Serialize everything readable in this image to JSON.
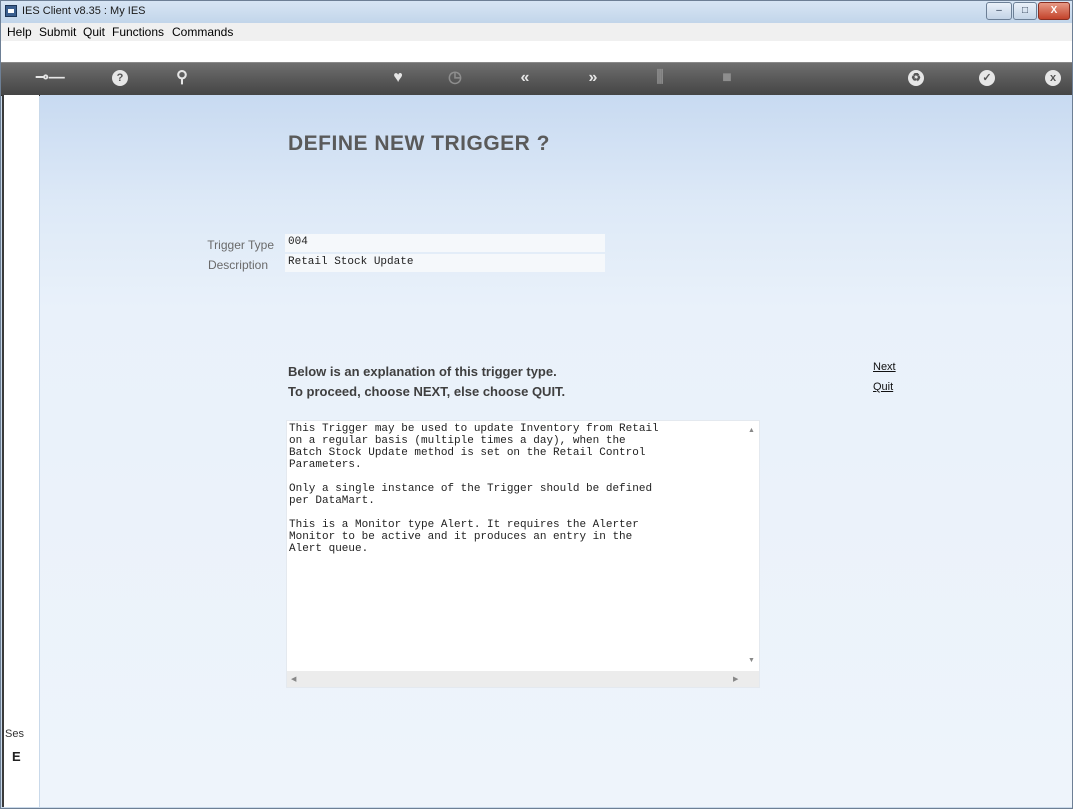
{
  "window": {
    "title": "IES Client v8.35 : My IES",
    "min_label": "–",
    "max_label": "□",
    "close_label": "X"
  },
  "menu": [
    "Help",
    "Submit",
    "Quit",
    "Functions",
    "Commands"
  ],
  "toolbar": {
    "icons": [
      "key-icon",
      "help-icon",
      "search-icon",
      "heart-icon",
      "clock-icon",
      "rewind-icon",
      "fast-forward-icon",
      "bookmark-icon",
      "stop-icon",
      "recycle-icon",
      "check-icon",
      "close-icon"
    ]
  },
  "page": {
    "title": "DEFINE NEW TRIGGER ?",
    "fields": [
      {
        "label": "Trigger Type",
        "value": "004"
      },
      {
        "label": "Description",
        "value": "Retail Stock Update"
      }
    ],
    "info_line1": "Below is an explanation of this trigger type.",
    "info_line2": "To proceed, choose NEXT, else choose QUIT.",
    "next_label": "Next",
    "quit_label": "Quit",
    "explanation": [
      "This Trigger may be used to update Inventory from Retail\non a regular basis (multiple times a day), when the\nBatch Stock Update method is set on the Retail Control\nParameters.",
      "Only a single instance of the Trigger should be defined\nper DataMart.",
      "This is a Monitor type Alert. It requires the Alerter\nMonitor to be active and it produces an entry in the\nAlert queue."
    ]
  },
  "sidebar": {
    "label": "Ses",
    "glyph": "E"
  }
}
